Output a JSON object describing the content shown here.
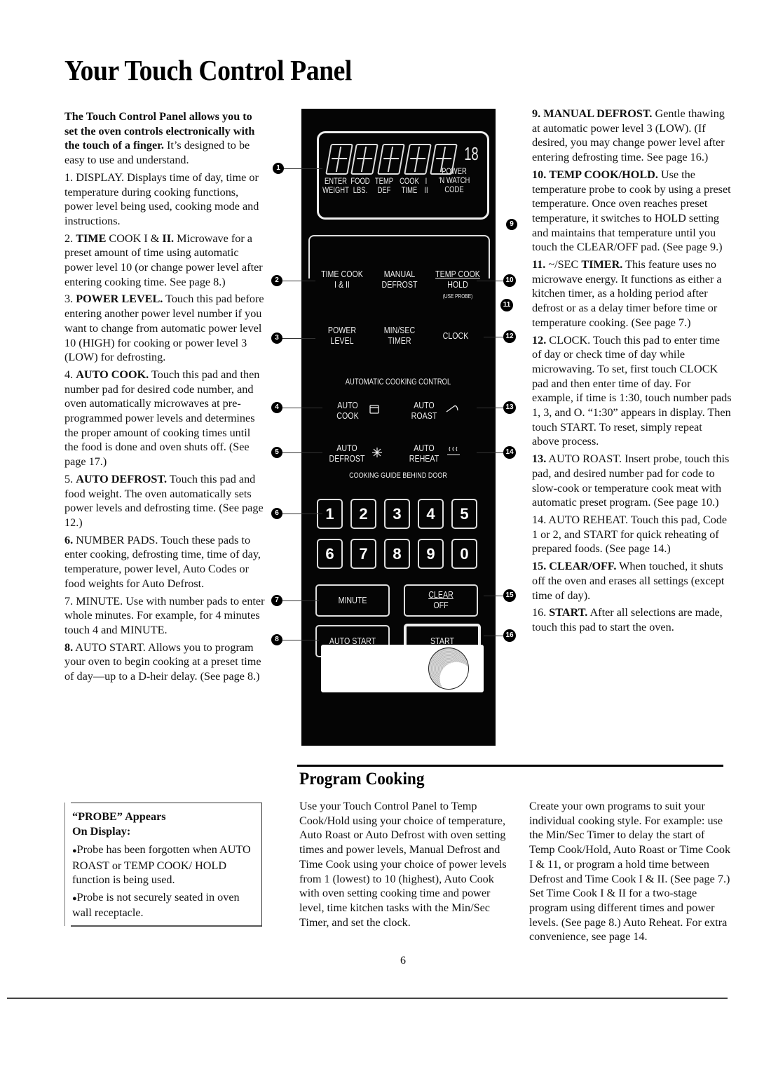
{
  "page": {
    "title": "Your Touch Control Panel",
    "page_number": "6"
  },
  "intro": {
    "lead_bold": "The Touch Control Panel allows you to set the oven controls electronically with the touch of a finger.",
    "lead_rest": " It’s designed to be easy to use and understand."
  },
  "items": [
    {
      "num": "1.",
      "name": "DISPLAY.",
      "name_bold": false,
      "text": " Displays time of day, time or temperature during cooking functions, power level being used, cooking mode and instructions."
    },
    {
      "num": "2.",
      "name": "TIME",
      "name_bold": true,
      "mid": " COOK I & ",
      "mid_bold": "II.",
      "text": " Microwave for a preset amount of time using automatic power level 10 (or change power level after entering cooking time. See page 8.)"
    },
    {
      "num": "3.",
      "name": "POWER LEVEL.",
      "name_bold": true,
      "text": " Touch this pad before entering another power level number if you want to change from automatic power level 10 (HIGH) for cooking or power level 3 (LOW) for defrosting."
    },
    {
      "num": "4.",
      "name": "AUTO COOK.",
      "name_bold": true,
      "text": " Touch this pad and then number pad for desired code number, and oven automatically microwaves at pre-programmed power levels and determines the proper amount of cooking times until the food is done and oven shuts off. (See page 17.)"
    },
    {
      "num": "5.",
      "name": "AUTO DEFROST.",
      "name_bold": true,
      "text": " Touch this pad and food weight. The oven automatically sets power levels and defrosting time. (See page 12.)"
    },
    {
      "num": "6.",
      "name": "NUMBER PADS.",
      "name_bold": false,
      "text": " Touch these pads to enter cooking, defrosting time, time of day, temperature, power level, Auto Codes or food weights for Auto Defrost."
    },
    {
      "num": "7.",
      "name": "MINUTE.",
      "name_bold": false,
      "text": " Use with number pads to enter whole minutes. For example, for 4 minutes touch 4 and MINUTE."
    },
    {
      "num": "8.",
      "name": "AUTO START.",
      "name_bold": false,
      "text": " Allows you to program your oven to begin cooking at a preset time of day—up to a D-heir delay. (See page 8.)"
    },
    {
      "num": "9.",
      "name": "MANUAL DEFROST.",
      "name_bold": true,
      "text": " Gentle thawing at automatic power level 3 (LOW). (If desired, you may change power level after entering defrosting time. See page 16.)"
    },
    {
      "num": "10.",
      "name": "TEMP COOK/HOLD.",
      "name_bold": true,
      "text": " Use the temperature probe to cook by using a preset temperature. Once oven reaches preset temperature, it switches to HOLD setting and maintains that temperature until you touch the CLEAR/OFF pad. (See page 9.)"
    },
    {
      "num": "11.",
      "name": " ~/SEC ",
      "name_bold": false,
      "mid_bold": "TIMER.",
      "text": " This feature uses no microwave energy. It functions as either a kitchen timer, as a holding period after defrost or as a delay timer before time or temperature cooking. (See page 7.)"
    },
    {
      "num": "12.",
      "name": "CLOCK.",
      "name_bold": false,
      "text": " Touch this pad to enter time of day or check time of day while microwaving. To set, first touch CLOCK pad and then enter time of day. For example, if time is 1:30, touch number pads 1, 3, and O. “1:30” appears in display. Then touch START. To reset, simply repeat above process."
    },
    {
      "num": "13.",
      "name": "AUTO ROAST.",
      "name_bold": false,
      "text": " Insert probe, touch this pad, and desired number pad for code to slow-cook or temperature cook meat with automatic preset program. (See page 10.)"
    },
    {
      "num": "14.",
      "name": "AUTO REHEAT.",
      "name_bold": false,
      "text": " Touch this pad, Code 1 or 2, and START for quick reheating of prepared foods. (See page 14.)"
    },
    {
      "num": "15.",
      "name": "CLEAR/OFF.",
      "name_bold": true,
      "text": " When touched, it shuts off the oven and erases all settings (except time of day)."
    },
    {
      "num": "16.",
      "name": "START.",
      "name_bold": true,
      "text": " After all selections are made, touch this pad to start the oven."
    }
  ],
  "probe_box": {
    "heading_line1": "“PROBE” Appears",
    "heading_line2": "On Display:",
    "bullets": [
      "Probe has been forgotten when AUTO ROAST or TEMP COOK/ HOLD function is being used.",
      "Probe is not securely seated in oven wall receptacle."
    ]
  },
  "program_cooking": {
    "heading": "Program Cooking",
    "left_text": "Use your Touch Control Panel to Temp Cook/Hold using your choice of temperature, Auto Roast or Auto Defrost with oven setting times and power levels, Manual Defrost and Time Cook using your choice of power levels from 1 (lowest) to 10 (highest), Auto Cook with oven setting cooking time and power level, time kitchen tasks with the Min/Sec Timer, and set the clock.",
    "right_text": "Create your own programs to suit your individual cooking style. For example: use the Min/Sec Timer to delay the start of Temp Cook/Hold, Auto Roast or Time Cook I & 11, or program a hold time between Defrost and Time Cook I & II. (See page 7.) Set Time Cook I & II for a two-stage program using different times and power levels. (See page 8.) Auto Reheat. For extra convenience, see page 14."
  },
  "panel": {
    "display": {
      "small_digits": "18",
      "labels": [
        {
          "line1": "ENTER",
          "line2": "WEIGHT"
        },
        {
          "line1": "FOOD",
          "line2": "LBS."
        },
        {
          "line1": "TEMP",
          "line2": "DEF"
        },
        {
          "line1": "COOK",
          "line2": "TIME"
        },
        {
          "line1": "I",
          "line2": "II"
        },
        {
          "line1": "POWER",
          "line2": "'N WATCH",
          "line3": "CODE"
        }
      ]
    },
    "function_pads": [
      {
        "line1": "TIME COOK",
        "line2": "I & II"
      },
      {
        "line1": "MANUAL",
        "line2": "DEFROST"
      },
      {
        "line1": "TEMP COOK",
        "line2": "HOLD",
        "line3": "(USE PROBE)"
      },
      {
        "line1": "POWER",
        "line2": "LEVEL"
      },
      {
        "line1": "MIN/SEC",
        "line2": "TIMER"
      },
      {
        "line1": "CLOCK"
      }
    ],
    "auto_heading": "AUTOMATIC COOKING CONTROL",
    "auto_pads": [
      {
        "line1": "AUTO",
        "line2": "COOK",
        "icon": "pot-icon"
      },
      {
        "line1": "AUTO",
        "line2": "ROAST",
        "icon": "probe-icon"
      },
      {
        "line1": "AUTO",
        "line2": "DEFROST",
        "icon": "snowflake-icon"
      },
      {
        "line1": "AUTO",
        "line2": "REHEAT",
        "icon": "steam-icon"
      }
    ],
    "guide_text": "COOKING GUIDE BEHIND DOOR",
    "number_pads": [
      "1",
      "2",
      "3",
      "4",
      "5",
      "6",
      "7",
      "8",
      "9",
      "0"
    ],
    "minute_label": "MINUTE",
    "clear_line1": "CLEAR",
    "clear_line2": "OFF",
    "auto_start_label": "AUTO START",
    "start_label": "START"
  },
  "callouts": [
    "1",
    "2",
    "3",
    "4",
    "5",
    "6",
    "7",
    "8",
    "9",
    "10",
    "11",
    "12",
    "13",
    "14",
    "15",
    "16"
  ]
}
